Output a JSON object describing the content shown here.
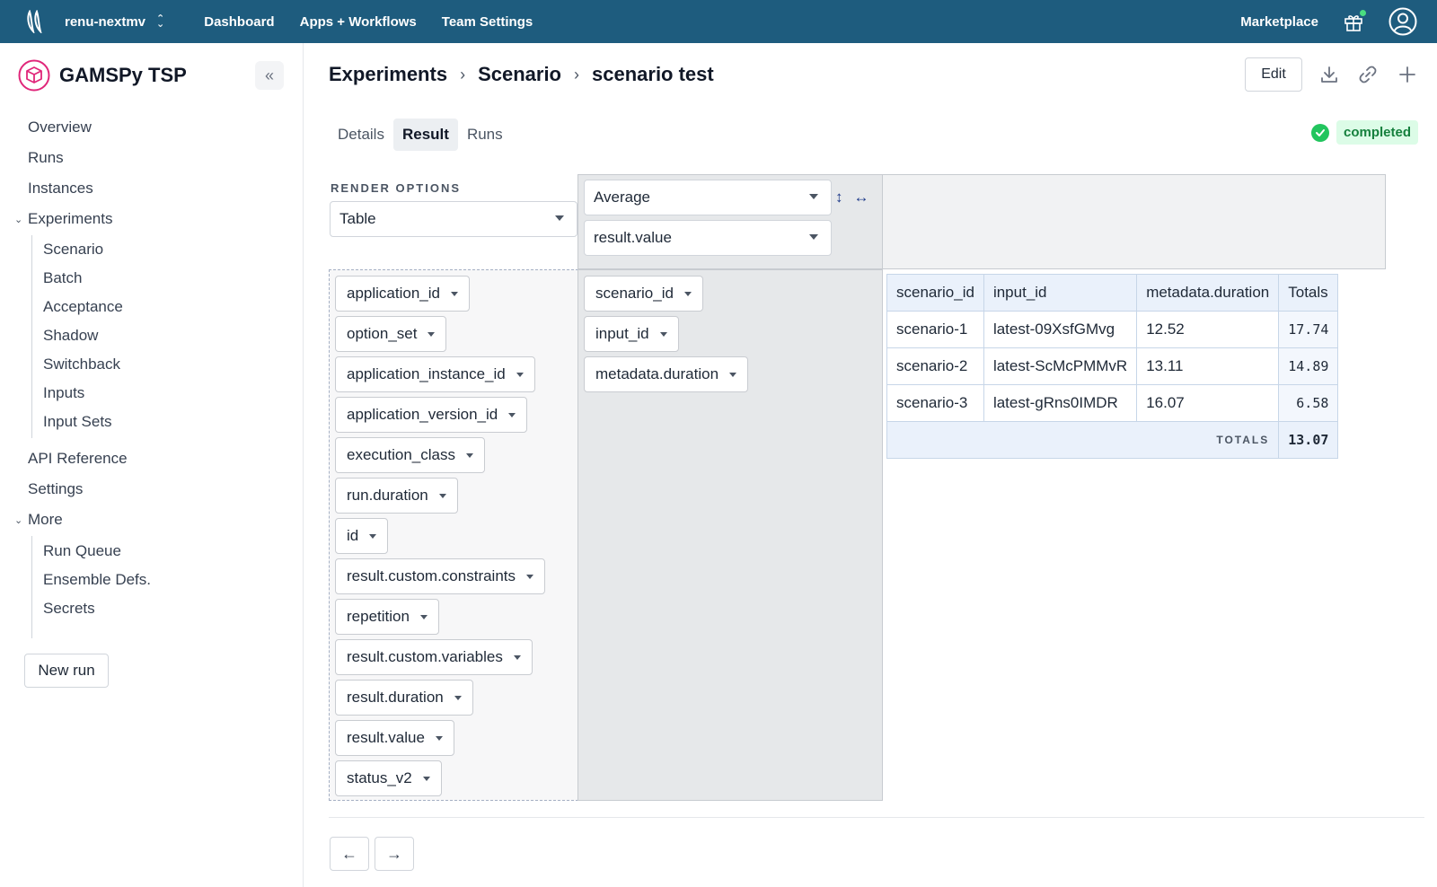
{
  "topbar": {
    "org": "renu-nextmv",
    "nav": [
      "Dashboard",
      "Apps + Workflows",
      "Team Settings"
    ],
    "marketplace": "Marketplace"
  },
  "sidebar": {
    "app_title": "GAMSPy TSP",
    "items": {
      "overview": "Overview",
      "runs": "Runs",
      "instances": "Instances",
      "experiments": "Experiments",
      "scenario": "Scenario",
      "batch": "Batch",
      "acceptance": "Acceptance",
      "shadow": "Shadow",
      "switchback": "Switchback",
      "inputs": "Inputs",
      "input_sets": "Input Sets",
      "api_reference": "API Reference",
      "settings": "Settings",
      "more": "More",
      "run_queue": "Run Queue",
      "ensemble_defs": "Ensemble Defs.",
      "secrets": "Secrets"
    },
    "new_run": "New run"
  },
  "header": {
    "breadcrumb": [
      "Experiments",
      "Scenario",
      "scenario test"
    ],
    "edit": "Edit"
  },
  "tabs": [
    "Details",
    "Result",
    "Runs"
  ],
  "active_tab": "Result",
  "status": "completed",
  "pivot": {
    "render_options_label": "RENDER OPTIONS",
    "renderer": "Table",
    "aggregator": "Average",
    "aggregator_field": "result.value",
    "unused_attributes": [
      "application_id",
      "option_set",
      "application_instance_id",
      "application_version_id",
      "execution_class",
      "run.duration",
      "id",
      "result.custom.constraints",
      "repetition",
      "result.custom.variables",
      "result.duration",
      "result.value",
      "status_v2"
    ],
    "row_attributes": [
      "scenario_id",
      "input_id",
      "metadata.duration"
    ],
    "table": {
      "headers": [
        "scenario_id",
        "input_id",
        "metadata.duration",
        "Totals"
      ],
      "rows": [
        [
          "scenario-1",
          "latest-09XsfGMvg",
          "12.52",
          "17.74"
        ],
        [
          "scenario-2",
          "latest-ScMcPMMvR",
          "13.11",
          "14.89"
        ],
        [
          "scenario-3",
          "latest-gRns0IMDR",
          "16.07",
          "6.58"
        ]
      ],
      "totals_label": "TOTALS",
      "grand_total": "13.07"
    }
  },
  "colors": {
    "topbar": "#1e5c7e",
    "success": "#22c55e",
    "brand_pink": "#e0267a"
  }
}
